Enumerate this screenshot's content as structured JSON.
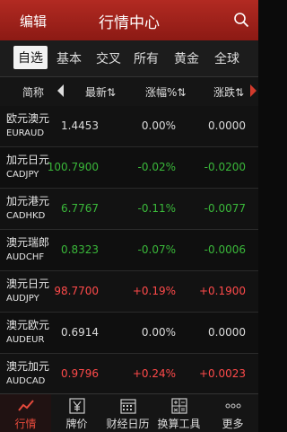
{
  "header": {
    "edit_label": "编辑",
    "title": "行情中心",
    "search_icon": "search-icon"
  },
  "tabs": [
    {
      "label": "自选",
      "active": true
    },
    {
      "label": "基本"
    },
    {
      "label": "交叉"
    },
    {
      "label": "所有"
    },
    {
      "label": "黄金"
    },
    {
      "label": "全球"
    }
  ],
  "columns": {
    "name": "简称",
    "latest": "最新⇅",
    "pct": "涨幅%⇅",
    "chg": "涨跌⇅"
  },
  "colors": {
    "up": "#ff4a4a",
    "down": "#3ab83a",
    "flat": "#dcdcdc",
    "accent": "#b22a22"
  },
  "rows": [
    {
      "cn": "欧元澳元",
      "code": "EURAUD",
      "latest": "1.4453",
      "pct": "0.00%",
      "chg": "0.0000",
      "dir": "flat"
    },
    {
      "cn": "加元日元",
      "code": "CADJPY",
      "latest": "100.7900",
      "pct": "-0.02%",
      "chg": "-0.0200",
      "dir": "down"
    },
    {
      "cn": "加元港元",
      "code": "CADHKD",
      "latest": "6.7767",
      "pct": "-0.11%",
      "chg": "-0.0077",
      "dir": "down"
    },
    {
      "cn": "澳元瑞郎",
      "code": "AUDCHF",
      "latest": "0.8323",
      "pct": "-0.07%",
      "chg": "-0.0006",
      "dir": "down"
    },
    {
      "cn": "澳元日元",
      "code": "AUDJPY",
      "latest": "98.7700",
      "pct": "+0.19%",
      "chg": "+0.1900",
      "dir": "up"
    },
    {
      "cn": "澳元欧元",
      "code": "AUDEUR",
      "latest": "0.6914",
      "pct": "0.00%",
      "chg": "0.0000",
      "dir": "flat"
    },
    {
      "cn": "澳元加元",
      "code": "AUDCAD",
      "latest": "0.9796",
      "pct": "+0.24%",
      "chg": "+0.0023",
      "dir": "up"
    }
  ],
  "bottom_nav": [
    {
      "label": "行情",
      "icon": "chart-icon",
      "active": true
    },
    {
      "label": "牌价",
      "icon": "yen-icon"
    },
    {
      "label": "财经日历",
      "icon": "calendar-icon"
    },
    {
      "label": "换算工具",
      "icon": "calculator-icon"
    },
    {
      "label": "更多",
      "icon": "more-icon"
    }
  ]
}
